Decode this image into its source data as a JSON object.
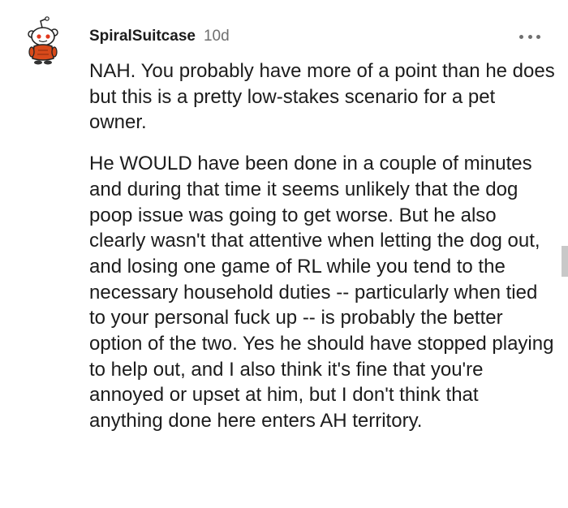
{
  "comment": {
    "username": "SpiralSuitcase",
    "timestamp": "10d",
    "paragraphs": [
      "NAH. You probably have more of a point than he does but this is a pretty low-stakes scenario for a pet owner.",
      "He WOULD have been done in a couple of minutes and during that time it seems unlikely that the dog poop issue was going to get worse. But he also clearly wasn't that attentive when letting the dog out, and losing one game of RL while you tend to the necessary household duties -- particularly when tied to your personal fuck up -- is probably the better option of the two. Yes he should have stopped playing to help out, and I also think it's fine that you're annoyed or upset at him, but I don't think that anything done here enters AH territory."
    ],
    "avatar_icon": "snoo-avatar-icon",
    "more_icon": "more-options-icon"
  },
  "colors": {
    "text": "#1c1c1c",
    "meta": "#6f6f6f",
    "avatar_shirt": "#d84a1b"
  }
}
